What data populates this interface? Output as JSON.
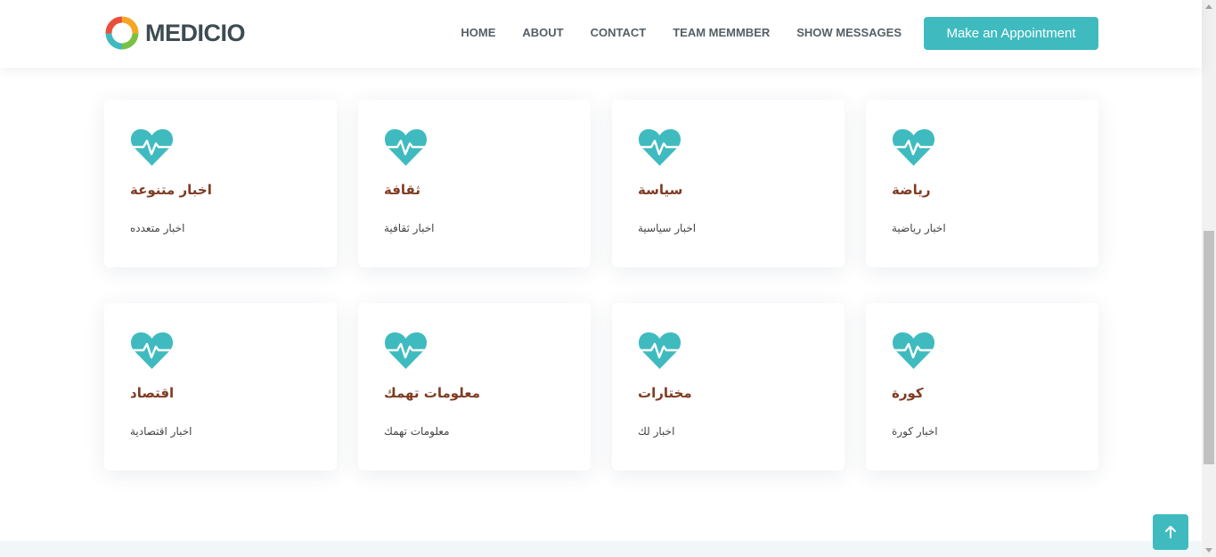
{
  "brand": {
    "name": "MEDICIO",
    "colors": {
      "accent": "#3fbbc0",
      "title": "#7f3b22",
      "text": "#444444"
    }
  },
  "nav": {
    "items": [
      {
        "label": "HOME"
      },
      {
        "label": "ABOUT"
      },
      {
        "label": "CONTACT"
      },
      {
        "label": "TEAM MEMMBER"
      },
      {
        "label": "SHOW MESSAGES"
      }
    ],
    "cta_label": "Make an Appointment"
  },
  "cards": [
    {
      "icon": "heartbeat-icon",
      "title": "اخبار متنوعة",
      "description": "اخبار متعدده"
    },
    {
      "icon": "heartbeat-icon",
      "title": "ثقافة",
      "description": "اخبار ثقافية"
    },
    {
      "icon": "heartbeat-icon",
      "title": "سياسة",
      "description": "اخبار سياسية"
    },
    {
      "icon": "heartbeat-icon",
      "title": "رياضة",
      "description": "اخبار رياضية"
    },
    {
      "icon": "heartbeat-icon",
      "title": "اقتصاد",
      "description": "اخبار اقتصادية"
    },
    {
      "icon": "heartbeat-icon",
      "title": "معلومات تهمك",
      "description": "معلومات تهمك"
    },
    {
      "icon": "heartbeat-icon",
      "title": "مختارات",
      "description": "اخبار لك"
    },
    {
      "icon": "heartbeat-icon",
      "title": "كورة",
      "description": "اخبار كورة"
    }
  ],
  "scroll_top": {
    "icon": "arrow-up-icon"
  }
}
